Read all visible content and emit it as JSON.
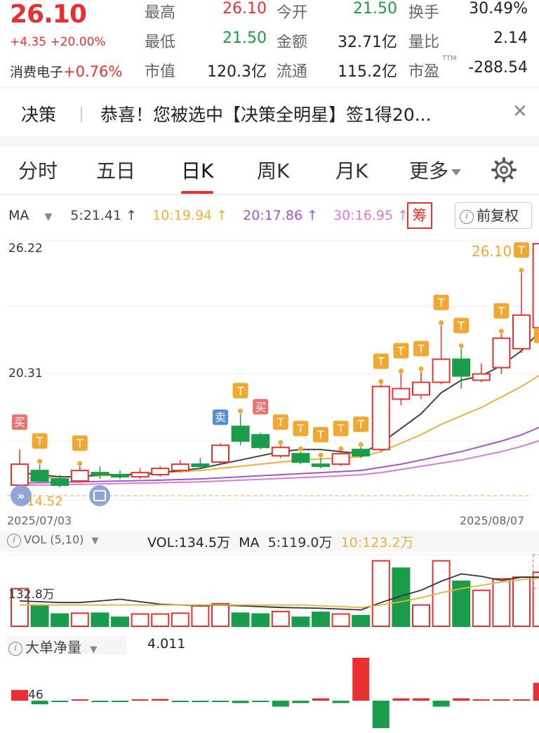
{
  "quote": {
    "price": "26.10",
    "change": "+4.35  +20.00%",
    "sector_name": "消费电子",
    "sector_change": "+0.76%",
    "rows": [
      [
        {
          "label": "最高",
          "value": "26.10",
          "color": "red"
        },
        {
          "label": "今开",
          "value": "21.50",
          "color": "green"
        },
        {
          "label": "换手",
          "value": "30.49%",
          "color": "dark"
        }
      ],
      [
        {
          "label": "最低",
          "value": "21.50",
          "color": "green"
        },
        {
          "label": "金额",
          "value": "32.71亿",
          "color": "dark"
        },
        {
          "label": "量比",
          "value": "2.14",
          "color": "dark"
        }
      ],
      [
        {
          "label": "市值",
          "value": "120.3亿",
          "color": "dark"
        },
        {
          "label": "流通",
          "value": "115.2亿",
          "color": "dark"
        },
        {
          "label": "市盈",
          "value": "-288.54",
          "color": "dark"
        }
      ]
    ],
    "pe_mark": "TTM"
  },
  "notice": {
    "tag": "决策",
    "message": "恭喜！您被选中【决策全明星】签1得20..."
  },
  "tabs": [
    "分时",
    "五日",
    "日K",
    "周K",
    "月K",
    "更多"
  ],
  "active_tab": "日K",
  "ma": {
    "label": "MA",
    "items": [
      "5:21.41 ↑",
      "10:19.94 ↑",
      "20:17.86 ↑",
      "30:16.95 ↑"
    ],
    "colors": [
      "#444",
      "#e8b33a",
      "#9b59d0",
      "#e07ad0"
    ]
  },
  "chou_label": "筹",
  "fuquan_label": "前复权",
  "price_axis": {
    "top": "26.22",
    "mid": "20.31",
    "low_mark": "14.52",
    "high_mark": "26.10"
  },
  "dates": {
    "start": "2025/07/03",
    "end": "2025/08/07"
  },
  "vol": {
    "selector": "VOL (5,10)",
    "value": "VOL:134.5万",
    "ma_label": "MA",
    "ma5": "5:119.0万",
    "ma10": "10:123.2万",
    "axis": "132.8万"
  },
  "dadan": {
    "selector": "大单净量",
    "value": "4.011",
    "axis_partial": "46"
  },
  "chart_data": {
    "type": "candlestick",
    "y_axis_labels": [
      "26.22",
      "20.31"
    ],
    "candles": [
      {
        "o": 14.6,
        "c": 15.6,
        "h": 16.3,
        "l": 14.5,
        "up": true
      },
      {
        "o": 15.3,
        "c": 14.8,
        "h": 15.6,
        "l": 14.7,
        "up": false
      },
      {
        "o": 14.9,
        "c": 14.6,
        "h": 15.1,
        "l": 14.5,
        "up": false
      },
      {
        "o": 14.8,
        "c": 15.3,
        "h": 15.5,
        "l": 14.7,
        "up": true
      },
      {
        "o": 15.2,
        "c": 15.1,
        "h": 15.5,
        "l": 14.9,
        "up": false
      },
      {
        "o": 15.1,
        "c": 15.0,
        "h": 15.3,
        "l": 14.9,
        "up": false
      },
      {
        "o": 15.0,
        "c": 15.2,
        "h": 15.4,
        "l": 14.9,
        "up": true
      },
      {
        "o": 15.1,
        "c": 15.4,
        "h": 15.5,
        "l": 15.0,
        "up": true
      },
      {
        "o": 15.3,
        "c": 15.6,
        "h": 15.8,
        "l": 15.2,
        "up": true
      },
      {
        "o": 15.6,
        "c": 15.5,
        "h": 15.9,
        "l": 15.4,
        "up": false
      },
      {
        "o": 15.7,
        "c": 16.5,
        "h": 16.6,
        "l": 15.6,
        "up": true
      },
      {
        "o": 17.4,
        "c": 16.7,
        "h": 18.0,
        "l": 16.5,
        "up": false
      },
      {
        "o": 17.0,
        "c": 16.4,
        "h": 17.1,
        "l": 16.3,
        "up": false
      },
      {
        "o": 16.0,
        "c": 16.4,
        "h": 16.5,
        "l": 15.9,
        "up": true
      },
      {
        "o": 16.1,
        "c": 15.7,
        "h": 16.2,
        "l": 15.6,
        "up": false
      },
      {
        "o": 15.6,
        "c": 15.5,
        "h": 15.9,
        "l": 15.4,
        "up": false
      },
      {
        "o": 15.6,
        "c": 16.1,
        "h": 16.2,
        "l": 15.5,
        "up": true
      },
      {
        "o": 16.3,
        "c": 16.0,
        "h": 16.4,
        "l": 15.9,
        "up": false
      },
      {
        "o": 16.3,
        "c": 19.3,
        "h": 19.4,
        "l": 16.2,
        "up": true
      },
      {
        "o": 18.7,
        "c": 19.2,
        "h": 19.9,
        "l": 18.4,
        "up": true
      },
      {
        "o": 18.9,
        "c": 19.5,
        "h": 20.0,
        "l": 18.7,
        "up": true
      },
      {
        "o": 19.5,
        "c": 20.6,
        "h": 22.2,
        "l": 19.4,
        "up": true
      },
      {
        "o": 20.6,
        "c": 19.8,
        "h": 21.1,
        "l": 19.2,
        "up": false
      },
      {
        "o": 19.6,
        "c": 19.9,
        "h": 20.4,
        "l": 19.5,
        "up": true
      },
      {
        "o": 20.2,
        "c": 21.6,
        "h": 21.8,
        "l": 19.9,
        "up": true
      },
      {
        "o": 21.1,
        "c": 22.7,
        "h": 24.7,
        "l": 20.9,
        "up": true
      },
      {
        "o": 22.1,
        "c": 26.1,
        "h": 26.1,
        "l": 22.1,
        "up": true
      }
    ],
    "ma_lines": {
      "ma5": [
        15.2,
        15.1,
        15.0,
        15.0,
        15.1,
        15.1,
        15.1,
        15.2,
        15.3,
        15.4,
        15.6,
        15.8,
        16.0,
        16.2,
        16.3,
        16.3,
        16.2,
        16.1,
        16.6,
        17.3,
        18.0,
        19.0,
        19.6,
        19.8,
        20.3,
        21.0,
        22.0
      ],
      "ma10": [
        14.9,
        14.95,
        15.0,
        15.0,
        15.05,
        15.1,
        15.15,
        15.2,
        15.25,
        15.3,
        15.4,
        15.5,
        15.6,
        15.7,
        15.8,
        15.85,
        15.9,
        15.95,
        16.2,
        16.6,
        17.0,
        17.5,
        17.9,
        18.3,
        18.8,
        19.3,
        19.9
      ],
      "ma20": [
        14.7,
        14.72,
        14.74,
        14.76,
        14.78,
        14.8,
        14.82,
        14.84,
        14.87,
        14.9,
        14.95,
        15.0,
        15.05,
        15.1,
        15.15,
        15.2,
        15.25,
        15.3,
        15.45,
        15.6,
        15.8,
        16.0,
        16.2,
        16.45,
        16.7,
        17.0,
        17.4
      ],
      "ma30": [
        14.6,
        14.61,
        14.62,
        14.64,
        14.66,
        14.68,
        14.7,
        14.72,
        14.74,
        14.76,
        14.8,
        14.84,
        14.88,
        14.92,
        14.96,
        15.0,
        15.05,
        15.1,
        15.2,
        15.35,
        15.5,
        15.65,
        15.8,
        16.0,
        16.2,
        16.45,
        16.75
      ]
    },
    "signals": [
      {
        "i": 0,
        "text": "买",
        "kind": "buy"
      },
      {
        "i": 1,
        "text": "T",
        "kind": "t"
      },
      {
        "i": 3,
        "text": "T",
        "kind": "t"
      },
      {
        "i": 10,
        "text": "卖",
        "kind": "sell"
      },
      {
        "i": 11,
        "text": "T",
        "kind": "t"
      },
      {
        "i": 12,
        "text": "买",
        "kind": "buy"
      },
      {
        "i": 13,
        "text": "T",
        "kind": "t"
      },
      {
        "i": 14,
        "text": "T",
        "kind": "t"
      },
      {
        "i": 15,
        "text": "T",
        "kind": "t"
      },
      {
        "i": 16,
        "text": "T",
        "kind": "t"
      },
      {
        "i": 17,
        "text": "T",
        "kind": "t"
      },
      {
        "i": 18,
        "text": "T",
        "kind": "t"
      },
      {
        "i": 19,
        "text": "T",
        "kind": "t"
      },
      {
        "i": 20,
        "text": "T",
        "kind": "t"
      },
      {
        "i": 21,
        "text": "T",
        "kind": "t"
      },
      {
        "i": 22,
        "text": "T",
        "kind": "t"
      },
      {
        "i": 24,
        "text": "T",
        "kind": "t"
      },
      {
        "i": 25,
        "text": "T",
        "kind": "t"
      },
      {
        "i": 26,
        "text": "T",
        "kind": "t"
      }
    ],
    "volume": {
      "values": [
        92,
        52,
        30,
        32,
        32,
        22,
        30,
        30,
        32,
        50,
        55,
        32,
        30,
        36,
        22,
        34,
        30,
        26,
        160,
        142,
        52,
        160,
        110,
        88,
        116,
        120,
        132
      ],
      "up": [
        true,
        false,
        false,
        true,
        false,
        false,
        true,
        true,
        true,
        true,
        true,
        false,
        false,
        true,
        false,
        false,
        true,
        false,
        true,
        false,
        true,
        true,
        false,
        true,
        true,
        true,
        true
      ]
    },
    "dadan": {
      "values": [
        0.9,
        -0.3,
        -0.1,
        0.1,
        -0.05,
        -0.05,
        0.1,
        0.15,
        -0.05,
        -0.05,
        -0.1,
        -0.2,
        -0.1,
        -0.5,
        -0.2,
        0.2,
        -0.2,
        3.6,
        -2.3,
        0.2,
        0.2,
        -0.5,
        0.2,
        0.1,
        0.1,
        0.1,
        1.5
      ],
      "up": [
        true,
        false,
        false,
        true,
        false,
        false,
        true,
        true,
        false,
        false,
        false,
        false,
        false,
        false,
        false,
        true,
        false,
        true,
        false,
        true,
        true,
        false,
        true,
        true,
        true,
        true,
        true
      ]
    }
  },
  "colors": {
    "up": "#e93030",
    "down": "#1a9d4a",
    "ma5": "#444",
    "ma10": "#e8b33a",
    "ma20": "#9b59d0",
    "ma30": "#e07ad0",
    "signal": "#f0a830"
  }
}
